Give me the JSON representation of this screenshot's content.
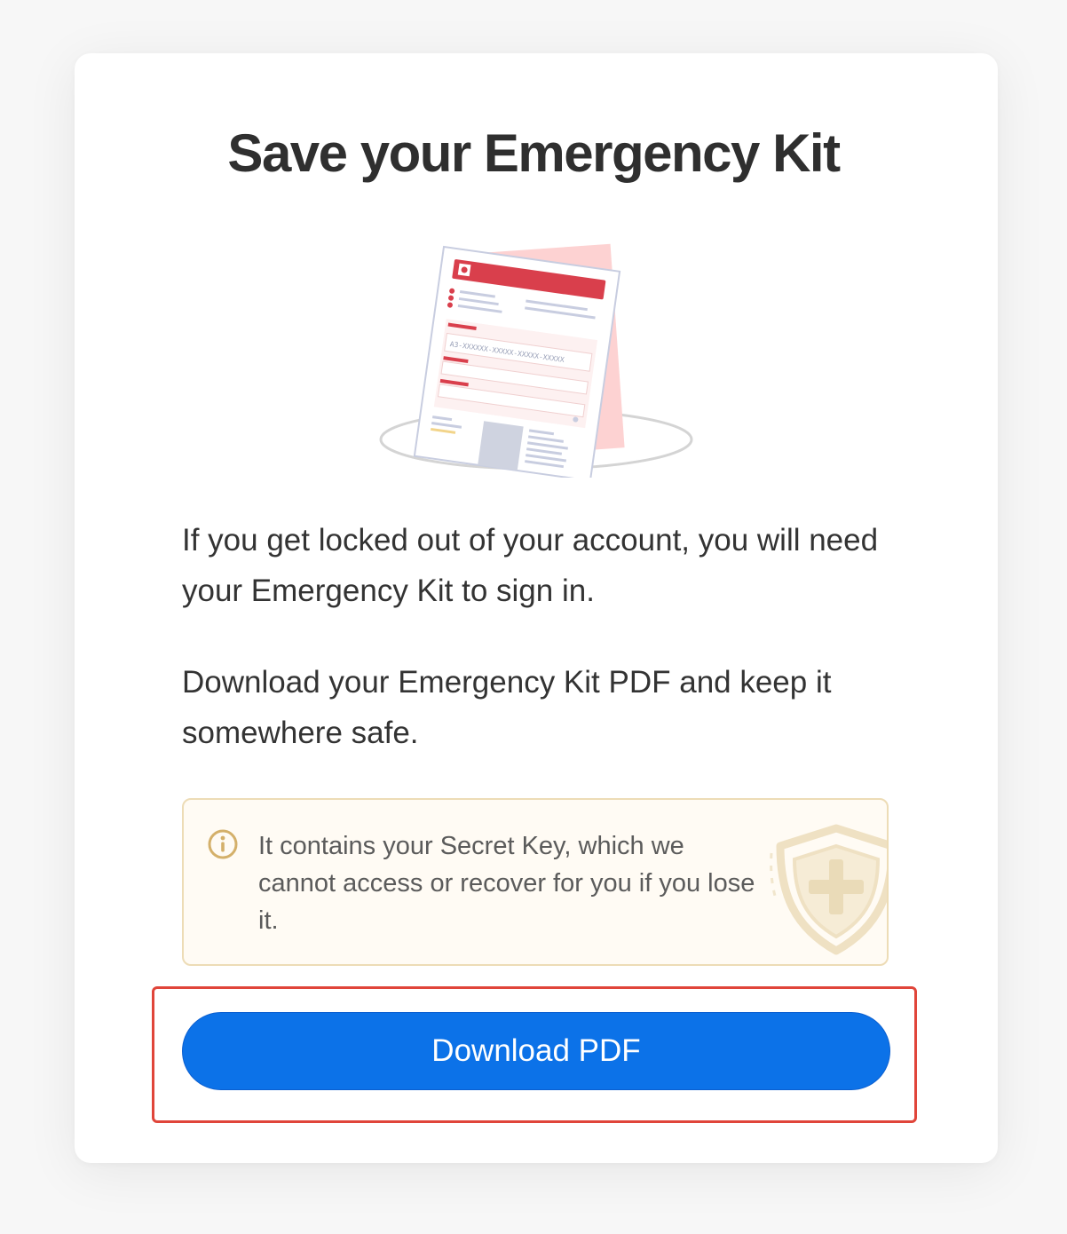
{
  "dialog": {
    "title": "Save your Emergency Kit",
    "paragraph_1": "If you get locked out of your account, you will need your Emergency Kit to sign in.",
    "paragraph_2": "Download your Emergency Kit PDF and keep it somewhere safe.",
    "notice": {
      "icon": "info-icon",
      "text": "It contains your Secret Key, which we cannot access or recover for you if you lose it.",
      "decoration_icon": "shield-plus-icon"
    },
    "download_button_label": "Download PDF"
  },
  "illustration": {
    "icon": "emergency-kit-document-icon",
    "secret_key_placeholder": "A3-XXXXXX-XXXXX-XXXXX-XXXXX"
  },
  "colors": {
    "primary_button": "#0c72e8",
    "highlight_border": "#e0453a",
    "notice_border": "#eddcb6",
    "notice_background": "#fffbf4",
    "kit_red": "#d93f4c"
  }
}
